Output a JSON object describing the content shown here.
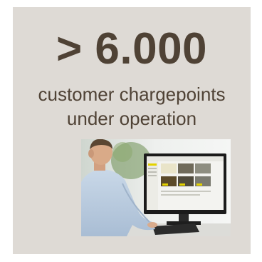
{
  "stat": {
    "value": "> 6.000",
    "caption_line1": "customer chargepoints",
    "caption_line2": "under operation"
  },
  "colors": {
    "card_background": "#dedad5",
    "text": "#4f4235"
  },
  "photo": {
    "icon": "person-at-monitor-photo"
  }
}
